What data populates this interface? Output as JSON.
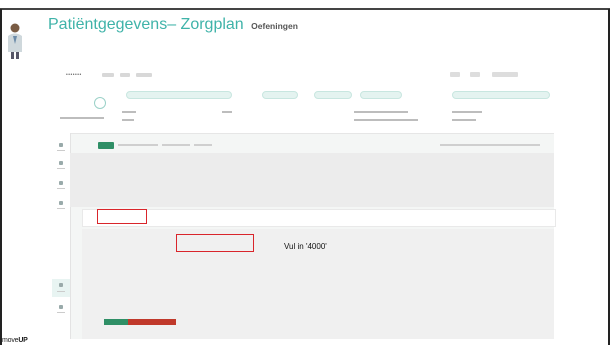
{
  "slide": {
    "title": "Patiëntgegevens– Zorgplan",
    "subtitle": "Oefeningen",
    "hint_text": "Vul in '4000'",
    "brand_light": "move",
    "brand_bold": "UP"
  },
  "colors": {
    "title_teal": "#3fb3a9",
    "accent_green": "#2f8f66",
    "annotation_red": "#d9252b"
  },
  "icons": [
    "doctor-avatar-icon"
  ]
}
